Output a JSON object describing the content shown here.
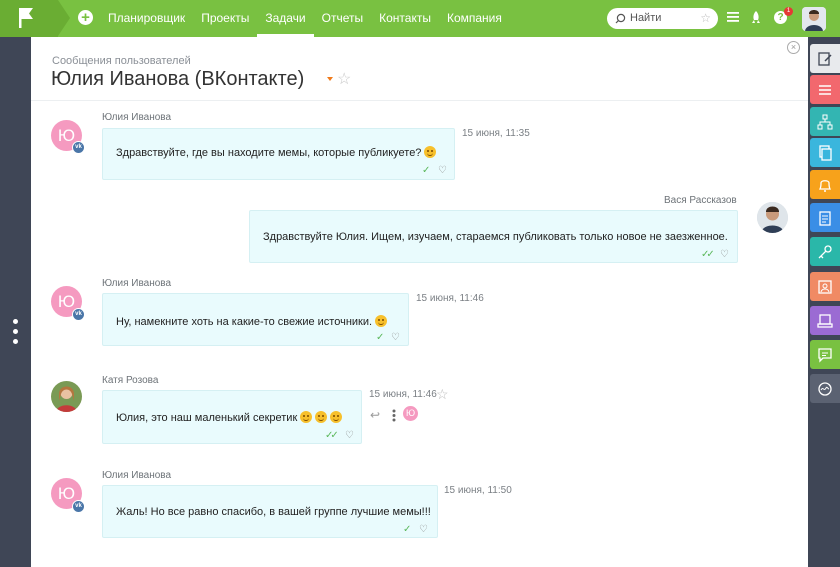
{
  "topbar": {
    "nav": [
      "Планировщик",
      "Проекты",
      "Задачи",
      "Отчеты",
      "Контакты",
      "Компания"
    ],
    "active_nav": "Задачи",
    "search_placeholder": "Найти",
    "help_badge": "1",
    "accent_color": "#79c141"
  },
  "page": {
    "breadcrumb": "Сообщения пользователей",
    "title": "Юлия Иванова (ВКонтакте)"
  },
  "messages": [
    {
      "author": "Юлия Иванова",
      "avatar_letter": "Ю",
      "text": "Здравствуйте, где вы находите мемы, которые публикуете?",
      "time": "15 июня, 11:35",
      "channel": "vk"
    },
    {
      "author": "Вася Рассказов",
      "text": "Здравствуйте Юлия. Ищем, изучаем, стараемся публиковать только новое не заезженное.",
      "time": ""
    },
    {
      "author": "Юлия Иванова",
      "avatar_letter": "Ю",
      "text": "Ну, намекните хоть на какие-то свежие источники.",
      "time": "15 июня, 11:46",
      "channel": "vk"
    },
    {
      "author": "Катя Розова",
      "text": "Юлия, это наш маленький секретик",
      "time": "15 июня, 11:46",
      "reader_letter": "Ю"
    },
    {
      "author": "Юлия Иванова",
      "avatar_letter": "Ю",
      "text": "Жаль! Но все равно спасибо, в вашей группе лучшие мемы!!!",
      "time": "15 июня, 11:50",
      "channel": "vk"
    }
  ],
  "right_rail": [
    {
      "icon": "edit-icon",
      "color": "#3f4656"
    },
    {
      "icon": "list-icon",
      "color": "#f2686e"
    },
    {
      "icon": "hierarchy-icon",
      "color": "#33b5b2"
    },
    {
      "icon": "documents-icon",
      "color": "#3ab6dd"
    },
    {
      "icon": "bell-icon",
      "color": "#f7a21b"
    },
    {
      "icon": "clipboard-icon",
      "color": "#3a8ee6"
    },
    {
      "icon": "key-icon",
      "color": "#2ab7a9"
    },
    {
      "icon": "contact-card-icon",
      "color": "#f08a64"
    },
    {
      "icon": "inbox-icon",
      "color": "#9b6bd3"
    },
    {
      "icon": "chat-icon",
      "color": "#79c141"
    },
    {
      "icon": "wave-icon",
      "color": "#5b6272"
    }
  ]
}
